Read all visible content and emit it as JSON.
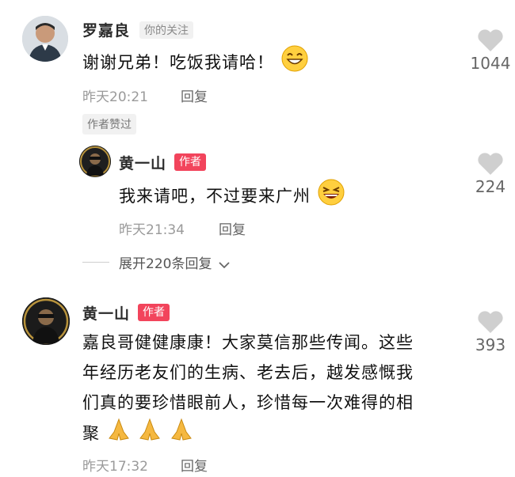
{
  "comments": [
    {
      "name": "罗嘉良",
      "follow_tag": "你的关注",
      "text": "谢谢兄弟！吃饭我请哈！",
      "time": "昨天20:21",
      "reply": "回复",
      "likes": "1044",
      "liked_by_author": "作者赞过"
    },
    {
      "name": "黄一山",
      "author_tag": "作者",
      "text": "我来请吧，不过要来广州",
      "time": "昨天21:34",
      "reply": "回复",
      "likes": "224",
      "expand": "展开220条回复"
    },
    {
      "name": "黄一山",
      "author_tag": "作者",
      "text_lines": [
        "嘉良哥健健康康！大家莫信那些传闻。这些",
        "年经历老友们的生病、老去后，越发感慨我",
        "们真的要珍惜眼前人，珍惜每一次难得的相",
        "聚"
      ],
      "time": "昨天17:32",
      "reply": "回复",
      "likes": "393"
    }
  ]
}
